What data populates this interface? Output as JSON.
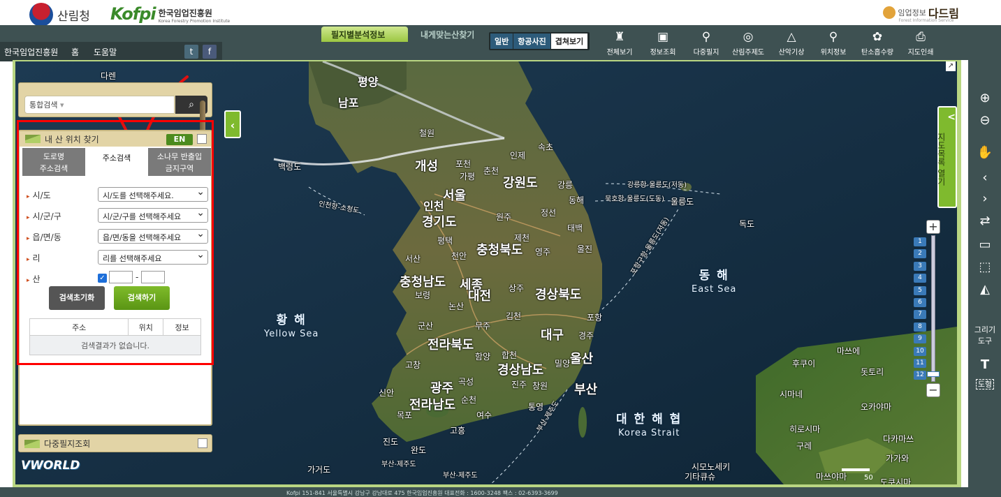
{
  "header": {
    "sanrimcheong": "산림청",
    "kofpi_mark": "Kofpi",
    "kofpi_name": "한국임업진흥원",
    "kofpi_sub": "Korea Forestry Promotion Institute",
    "daruim_prefix": "임업정보",
    "daruim_name": "다드림",
    "daruim_sub": "Forest Information Service"
  },
  "tabs": {
    "active": "필지별분석정보",
    "other": "내게맞는산찾기"
  },
  "map_types": [
    {
      "label": "일반"
    },
    {
      "label": "항공사진"
    },
    {
      "label": "겹쳐보기"
    }
  ],
  "tools": [
    {
      "label": "전체보기",
      "icon": "korea-map-icon"
    },
    {
      "label": "정보조회",
      "icon": "info-board-icon"
    },
    {
      "label": "다중필지",
      "icon": "multi-pin-icon"
    },
    {
      "label": "산림주제도",
      "icon": "theme-map-icon"
    },
    {
      "label": "산악기상",
      "icon": "mountain-weather-icon"
    },
    {
      "label": "위치정보",
      "icon": "location-pin-icon"
    },
    {
      "label": "탄소흡수량",
      "icon": "carbon-flower-icon"
    },
    {
      "label": "지도인쇄",
      "icon": "printer-icon"
    }
  ],
  "nav": {
    "home_org": "한국임업진흥원",
    "home": "홈",
    "help": "도움말",
    "twitter": "t",
    "facebook": "f"
  },
  "search": {
    "combo_label": "통합검색",
    "button_icon": "search-icon"
  },
  "find_panel": {
    "title": "내 산 위치 찾기",
    "en_button": "EN",
    "tabs": [
      {
        "line1": "도로명",
        "line2": "주소검색"
      },
      {
        "line1": "주소검색",
        "line2": ""
      },
      {
        "line1": "소나무 반출입",
        "line2": "금지구역"
      }
    ],
    "fields": [
      {
        "label": "시/도",
        "value": "시/도를 선택해주세요."
      },
      {
        "label": "시/군/구",
        "value": "시/군/구를 선택해주세요"
      },
      {
        "label": "읍/면/동",
        "value": "읍/면/동을 선택해주세요"
      },
      {
        "label": "리",
        "value": "리를 선택해주세요"
      }
    ],
    "mountain_label": "산",
    "mountain_dash": "-",
    "reset_button": "검색초기화",
    "search_button": "검색하기",
    "table": {
      "columns": [
        "주소",
        "위치",
        "정보"
      ],
      "empty": "검색결과가 없습니다."
    }
  },
  "multi_panel": {
    "title": "다중필지조회"
  },
  "toggle_panel_icon": "chevron-left-icon",
  "list_tab": {
    "label": "지도목록 열기",
    "arrow": "<"
  },
  "zoom": {
    "plus": "+",
    "minus": "−",
    "levels": [
      "1",
      "2",
      "3",
      "4",
      "5",
      "6",
      "7",
      "8",
      "9",
      "10",
      "11",
      "12"
    ],
    "current": 12
  },
  "right_tools": {
    "draw_label_1": "그리기",
    "draw_label_2": "도구",
    "text_tool": "T",
    "shape_tool": "도형"
  },
  "map_labels": {
    "small": [
      "다렌",
      "평양",
      "남포",
      "철원",
      "속초",
      "인제",
      "백령도",
      "포천",
      "가평",
      "춘천",
      "강릉",
      "동해",
      "원주",
      "정선",
      "태백",
      "제천",
      "영주",
      "울진",
      "평택",
      "천안",
      "서산",
      "보령",
      "논산",
      "상주",
      "김천",
      "포항",
      "경주",
      "군산",
      "무주",
      "고창",
      "함양",
      "합천",
      "밀양",
      "진주",
      "창원",
      "곡성",
      "신안",
      "순천",
      "통영",
      "여수",
      "목포",
      "고흥",
      "진도",
      "완도",
      "독도",
      "가거도",
      "후쿠이",
      "돗토리",
      "마쓰에",
      "시마네",
      "오카야마",
      "히로시마",
      "구레",
      "다카마쓰",
      "가가와",
      "도쿠시마",
      "마쓰야마",
      "시모노세키",
      "기타큐슈"
    ],
    "medium": [
      "개성",
      "인천",
      "서울",
      "경기도",
      "강원도",
      "충청북도",
      "충청남도",
      "세종",
      "대전",
      "경상북도",
      "전라북도",
      "대구",
      "울산",
      "경상남도",
      "부산",
      "광주",
      "전라남도"
    ],
    "routes": [
      "강릉항-울릉도(저동)",
      "묵호항-울릉도(도동)",
      "울릉도",
      "인천항-소청도",
      "포항구항-울릉도(저동)",
      "부산-제주도",
      "부산-제주도",
      "부산-제주도"
    ],
    "seas": [
      {
        "ko": "황 해",
        "en": "Yellow Sea"
      },
      {
        "ko": "동 해",
        "en": "East Sea"
      },
      {
        "ko": "대 한 해 협",
        "en": "Korea Strait"
      }
    ],
    "vworld": "VWORLD",
    "scale": "50"
  },
  "footer": "Kofpi 151-841 서울특별시 강남구 강남대로 475 한국임업진흥원 대표전화 : 1600-3248 팩스 : 02-6393-3699"
}
